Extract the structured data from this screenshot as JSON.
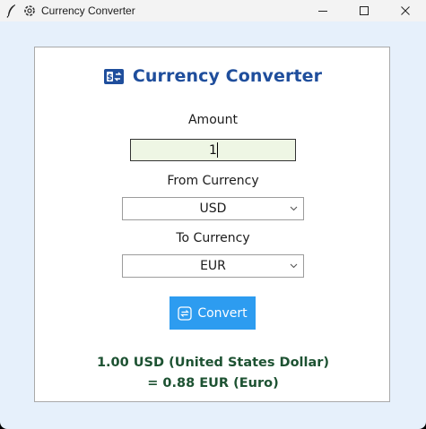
{
  "window": {
    "title": "Currency Converter",
    "icons": [
      "feather-icon",
      "app-gear-icon"
    ],
    "controls": [
      "minimize",
      "maximize",
      "close"
    ]
  },
  "app": {
    "heading": "Currency Converter",
    "heading_icon": "currency-exchange-icon",
    "amount_label": "Amount",
    "amount_value": "1",
    "from_label": "From Currency",
    "from_value": "USD",
    "to_label": "To Currency",
    "to_value": "EUR",
    "convert_label": "Convert",
    "result_line1": "1.00 USD (United States Dollar)",
    "result_line2": "= 0.88 EUR (Euro)"
  },
  "colors": {
    "window_bg": "#e6f0fb",
    "heading": "#1f4e9c",
    "button": "#2d9cf0",
    "input_bg": "#eef6e4",
    "result_text": "#1d5232"
  }
}
